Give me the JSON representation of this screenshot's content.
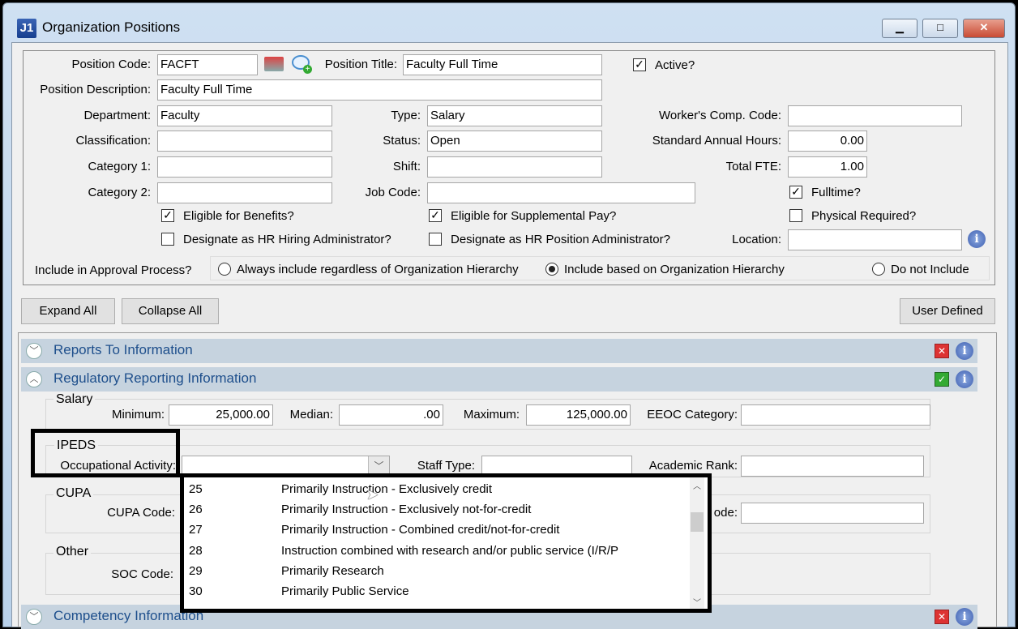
{
  "window": {
    "title": "Organization Positions",
    "logo": "J1"
  },
  "header": {
    "position_code_label": "Position Code:",
    "position_code": "FACFT",
    "position_title_label": "Position Title:",
    "position_title": "Faculty Full Time",
    "active_label": "Active?",
    "description_label": "Position Description:",
    "description": "Faculty Full Time",
    "department_label": "Department:",
    "department": "Faculty",
    "type_label": "Type:",
    "type": "Salary",
    "workers_comp_label": "Worker's Comp. Code:",
    "workers_comp": "",
    "classification_label": "Classification:",
    "classification": "",
    "status_label": "Status:",
    "status": "Open",
    "annual_hours_label": "Standard Annual Hours:",
    "annual_hours": "0.00",
    "category1_label": "Category 1:",
    "shift_label": "Shift:",
    "total_fte_label": "Total FTE:",
    "total_fte": "1.00",
    "category2_label": "Category 2:",
    "job_code_label": "Job Code:",
    "fulltime_label": "Fulltime?",
    "eligible_benefits_label": "Eligible for Benefits?",
    "eligible_supp_label": "Eligible for Supplemental Pay?",
    "physical_label": "Physical Required?",
    "hr_hiring_label": "Designate as HR Hiring Administrator?",
    "hr_position_label": "Designate as HR Position Administrator?",
    "location_label": "Location:",
    "approval_label": "Include in Approval Process?",
    "approval_options": [
      "Always include regardless of Organization Hierarchy",
      "Include based on Organization Hierarchy",
      "Do not Include"
    ]
  },
  "toolbar": {
    "expand": "Expand All",
    "collapse": "Collapse All",
    "user_defined": "User Defined"
  },
  "sections": {
    "reports": "Reports To Information",
    "regulatory": "Regulatory Reporting Information",
    "competency": "Competency Information"
  },
  "regulatory": {
    "salary_group": "Salary",
    "minimum_label": "Minimum:",
    "minimum": "25,000.00",
    "median_label": "Median:",
    "median": ".00",
    "maximum_label": "Maximum:",
    "maximum": "125,000.00",
    "eeoc_label": "EEOC Category:",
    "ipeds_group": "IPEDS",
    "occ_label": "Occupational Activity:",
    "staff_type_label": "Staff Type:",
    "academic_rank_label": "Academic Rank:",
    "cupa_group": "CUPA",
    "cupa_code_label": "CUPA Code:",
    "code_label": "ode:",
    "other_group": "Other",
    "soc_label": "SOC Code:"
  },
  "dropdown": [
    {
      "code": "25",
      "desc": "Primarily Instruction - Exclusively credit"
    },
    {
      "code": "26",
      "desc": "Primarily Instruction - Exclusively not-for-credit"
    },
    {
      "code": "27",
      "desc": "Primarily Instruction - Combined credit/not-for-credit"
    },
    {
      "code": "28",
      "desc": "Instruction combined with research and/or public service (I/R/P"
    },
    {
      "code": "29",
      "desc": "Primarily Research"
    },
    {
      "code": "30",
      "desc": "Primarily Public Service"
    }
  ]
}
